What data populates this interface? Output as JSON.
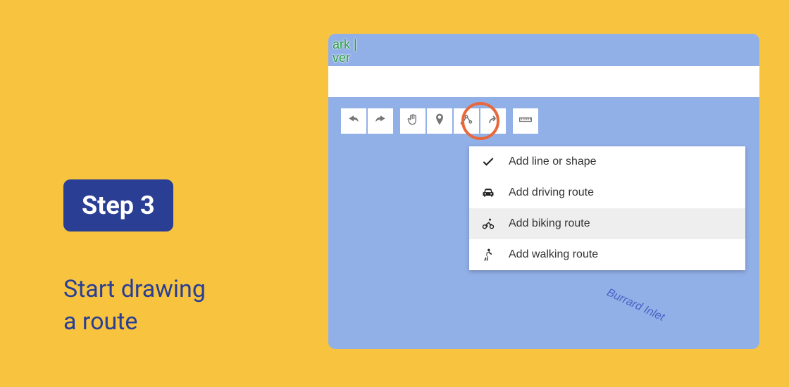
{
  "step": {
    "badge": "Step 3",
    "title_line1": "Start drawing",
    "title_line2": "a route"
  },
  "map": {
    "label_top_line1": "ark |",
    "label_top_line2": "ver",
    "water_label": "Burrard Inlet"
  },
  "toolbar": {
    "undo": "undo",
    "redo": "redo",
    "pan": "pan",
    "marker": "marker",
    "line": "line",
    "directions": "directions",
    "measure": "measure"
  },
  "menu": {
    "items": [
      {
        "icon": "check",
        "label": "Add line or shape",
        "selected": false
      },
      {
        "icon": "car",
        "label": "Add driving route",
        "selected": false
      },
      {
        "icon": "bike",
        "label": "Add biking route",
        "selected": true
      },
      {
        "icon": "walk",
        "label": "Add walking route",
        "selected": false
      }
    ]
  }
}
